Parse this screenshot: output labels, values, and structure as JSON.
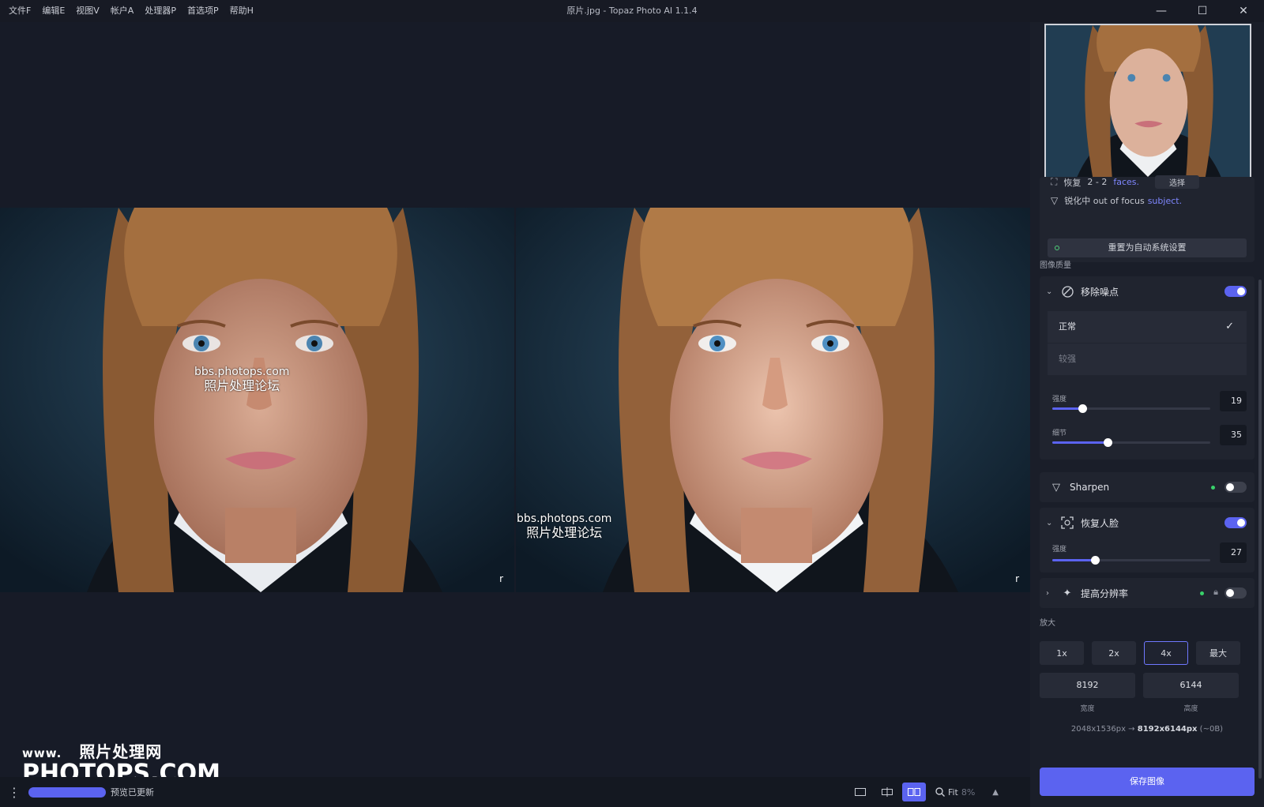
{
  "menu": [
    "文件F",
    "编辑E",
    "视图V",
    "帐户A",
    "处理器P",
    "首选项P",
    "帮助H"
  ],
  "window_title": "原片.jpg - Topaz Photo AI 1.1.4",
  "window_controls": {
    "minimize": "—",
    "maximize": "☐",
    "close": "✕"
  },
  "preview": {
    "corner_mark": "r",
    "watermark_line1": "bbs.photops.com",
    "watermark_line2": "照片处理论坛"
  },
  "brand": {
    "line1_left": "www.",
    "line1_right": "照片处理网",
    "line2": "PHOTOPS.COM"
  },
  "statusbar": {
    "progress_fraction": 1.0,
    "status_text": "预览已更新",
    "zoom_label": "Fit",
    "zoom_value": "8%"
  },
  "sidebar": {
    "auto": {
      "faces_prefix": "恢复",
      "faces_text": "2 - 2",
      "faces_link": "faces.",
      "select_label": "选择",
      "sharpen_prefix": "锐化中 out of focus",
      "sharpen_link": "subject.",
      "reset_label": "重置为自动系统设置"
    },
    "image_quality_label": "图像质量",
    "denoise": {
      "title": "移除噪点",
      "enabled": true,
      "options": [
        {
          "label": "正常",
          "selected": true
        },
        {
          "label": "较强",
          "selected": false
        }
      ],
      "strength_label": "强度",
      "strength": 19,
      "detail_label": "细节",
      "detail": 35
    },
    "sharpen": {
      "title": "Sharpen",
      "enabled": false
    },
    "face": {
      "title": "恢复人脸",
      "enabled": true,
      "strength_label": "强度",
      "strength": 27
    },
    "upscale": {
      "title": "提高分辨率",
      "enabled": false
    },
    "scale_label": "放大",
    "scales": [
      {
        "label": "1x",
        "active": false
      },
      {
        "label": "2x",
        "active": false
      },
      {
        "label": "4x",
        "active": true
      },
      {
        "label": "最大",
        "active": false
      }
    ],
    "width_value": "8192",
    "height_value": "6144",
    "width_caption": "宽度",
    "height_caption": "高度",
    "res_from": "2048x1536px →",
    "res_to": "8192x6144px",
    "res_size": "(~0B)",
    "save_label": "保存图像"
  },
  "colors": {
    "accent": "#5b63f0",
    "panel": "#20242f",
    "background": "#171b27"
  }
}
